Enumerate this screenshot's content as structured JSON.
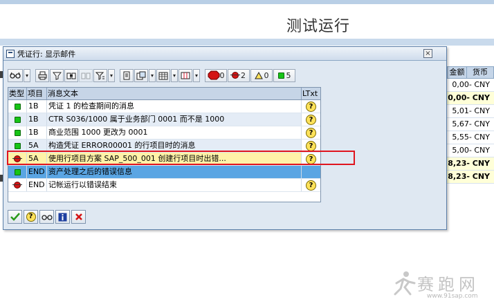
{
  "background": {
    "page_title": "测试运行",
    "columns": [
      "金额",
      "货币"
    ],
    "rows": [
      {
        "value": "0,00- CNY",
        "bold": false
      },
      {
        "value": "0,00- CNY",
        "bold": true
      },
      {
        "value": "5,01- CNY",
        "bold": false
      },
      {
        "value": "5,67- CNY",
        "bold": false
      },
      {
        "value": "5,55- CNY",
        "bold": false
      },
      {
        "value": "5,00- CNY",
        "bold": false
      },
      {
        "value": "8,23- CNY",
        "bold": true
      },
      {
        "value": "8,23- CNY",
        "bold": true
      }
    ]
  },
  "dialog": {
    "title": "凭证行: 显示邮件",
    "close_glyph": "×",
    "toolbar": {
      "stop_count": "0",
      "error_count": "2",
      "warning_count": "0",
      "success_count": "5",
      "stop_label": "STOP"
    },
    "table": {
      "headers": {
        "type": "类型",
        "item": "项目",
        "text": "消息文本",
        "ltxt": "LTxt"
      },
      "rows": [
        {
          "status": "green",
          "item": "1B",
          "text": "凭证 1 的检查期间的消息",
          "ltxt": true
        },
        {
          "status": "green",
          "item": "1B",
          "text": "CTR S036/1000 属于业务部门 0001 而不是 1000",
          "ltxt": true
        },
        {
          "status": "green",
          "item": "1B",
          "text": "商业范围 1000 更改为 0001",
          "ltxt": true
        },
        {
          "status": "green",
          "item": "5A",
          "text": "构造凭证 ERROR00001 的行项目时的消息",
          "ltxt": true
        },
        {
          "status": "red",
          "item": "5A",
          "text": "使用行项目方案 SAP_500_001 创建行项目时出错...",
          "ltxt": true
        },
        {
          "status": "green",
          "item": "END",
          "text": "资产处理之后的错误信息",
          "ltxt": false
        },
        {
          "status": "red",
          "item": "END",
          "text": "记帐运行以错误结束",
          "ltxt": true
        }
      ]
    }
  },
  "watermark": {
    "text": "赛跑网",
    "url": "www.91sap.com"
  },
  "colors": {
    "highlight_border": "#e0141e",
    "selected_row": "#fff2a8",
    "blue_row": "#5aa5e3"
  }
}
